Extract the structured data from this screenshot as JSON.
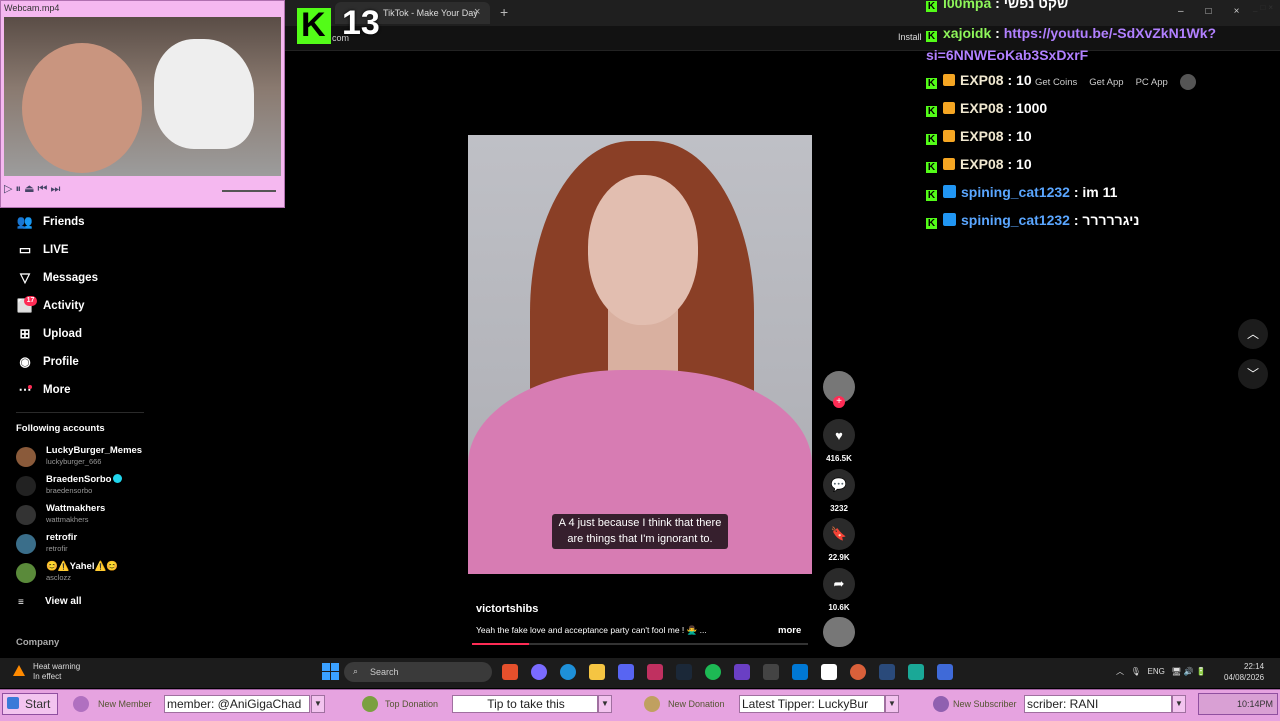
{
  "browser": {
    "tab_title": "TikTok - Make Your Day",
    "tab_close": "×",
    "new_tab": "+",
    "url_suffix": "com",
    "install": "Install"
  },
  "overlay": {
    "viewer_count": "13"
  },
  "webcam": {
    "title": "Webcam.mp4",
    "buttons": "_□×",
    "controls": "▷ ⏸ ⏏ ⏮ ⏭"
  },
  "sidebar": {
    "items": [
      {
        "label": "Friends",
        "icon": "friends-icon"
      },
      {
        "label": "LIVE",
        "icon": "live-icon"
      },
      {
        "label": "Messages",
        "icon": "messages-icon"
      },
      {
        "label": "Activity",
        "icon": "activity-icon"
      },
      {
        "label": "Upload",
        "icon": "upload-icon"
      },
      {
        "label": "Profile",
        "icon": "profile-icon"
      },
      {
        "label": "More",
        "icon": "more-icon"
      }
    ],
    "activity_badge": "17",
    "following_title": "Following accounts",
    "accounts": [
      {
        "name": "LuckyBurger_Memes",
        "handle": "luckyburger_666"
      },
      {
        "name": "BraedenSorbo",
        "handle": "braedensorbo"
      },
      {
        "name": "Wattmakhers",
        "handle": "wattmakhers"
      },
      {
        "name": "retrofir",
        "handle": "retrofir"
      },
      {
        "name": "😊⚠️Yahel⚠️😊",
        "handle": "asclozz"
      }
    ],
    "view_all": "View all",
    "company": "Company"
  },
  "video": {
    "caption": "A 4 just because I think that there are things that I'm ignorant to.",
    "author": "victortshibs",
    "description": "Yeah the fake love and acceptance party can't fool me ! 🙅‍♂️ ...",
    "more": "more",
    "progress": 0.17,
    "likes": "416.5K",
    "comments": "3232",
    "saves": "22.9K",
    "shares": "10.6K"
  },
  "tiktok_bar": {
    "get_coins": "Get Coins",
    "get_app": "Get App",
    "pc_app": "PC App"
  },
  "chat": [
    {
      "user": "l00mpa",
      "message": "שקט נפשי",
      "style": "green"
    },
    {
      "user": "xajoidk",
      "message": "https://youtu.be/-SdXvZkN1Wk?si=6NNWEoKab3SxDxrF",
      "style": "green-link"
    },
    {
      "user": "EXP08",
      "message": "10",
      "style": "exp"
    },
    {
      "user": "EXP08",
      "message": "1000",
      "style": "exp"
    },
    {
      "user": "EXP08",
      "message": "10",
      "style": "exp"
    },
    {
      "user": "EXP08",
      "message": "10",
      "style": "exp"
    },
    {
      "user": "spining_cat1232",
      "message": "im 11",
      "style": "blue"
    },
    {
      "user": "spining_cat1232",
      "message": "ניגררררר",
      "style": "blue"
    }
  ],
  "taskbar": {
    "heat_title": "Heat warning",
    "heat_sub": "In effect",
    "search": "Search",
    "lang": "ENG",
    "time": "22:14",
    "date": "04/08/2026"
  },
  "alerts": {
    "start": "Start",
    "new_member_label": "New Member",
    "new_member_value": "member: @AniGigaChad",
    "top_donation_label": "Top Donation",
    "top_donation_value": "Tip to take this",
    "new_donation_label": "New Donation",
    "new_donation_value": "Latest Tipper: LuckyBur",
    "new_subscriber_label": "New Subscriber",
    "new_subscriber_value": "scriber: RANI",
    "clock": "10:14PM"
  },
  "colors": {
    "accent_red": "#fe2c55",
    "kick_green": "#53fc18",
    "alert_pink": "#e6a3e0"
  }
}
